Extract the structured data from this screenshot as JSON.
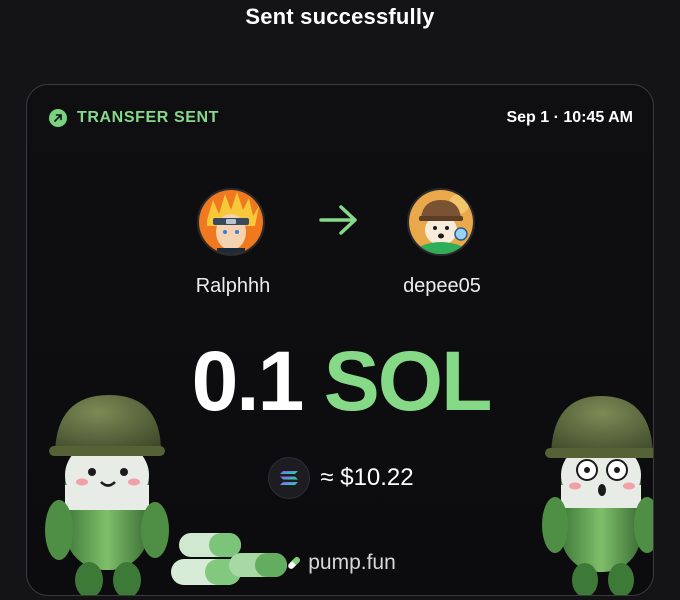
{
  "header": {
    "title": "Sent successfully"
  },
  "card": {
    "status_label": "TRANSFER SENT",
    "timestamp": "Sep 1 · 10:45 AM",
    "sender": {
      "name": "Ralphhh",
      "avatar_icon": "anime-ninja-avatar"
    },
    "recipient": {
      "name": "depee05",
      "avatar_icon": "cartoon-character-avatar"
    },
    "amount": {
      "value": "0.1",
      "unit": "SOL"
    },
    "usd_value": "≈ $10.22",
    "brand": "pump.fun"
  },
  "colors": {
    "accent_green": "#85d987",
    "background": "#141416",
    "card_border": "#3a3a3f"
  }
}
